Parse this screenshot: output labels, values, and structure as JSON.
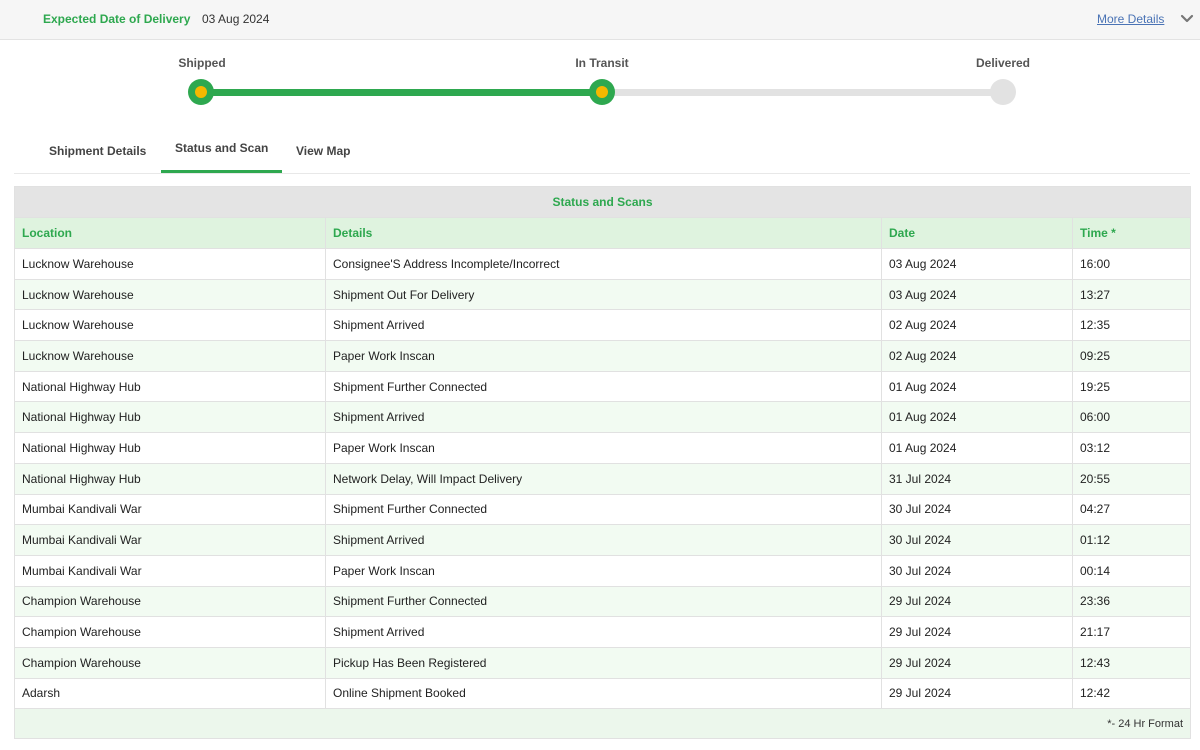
{
  "header": {
    "edd_label": "Expected Date of Delivery",
    "edd_value": "03 Aug 2024",
    "more_details": "More Details"
  },
  "tracker": {
    "stages": [
      "Shipped",
      "In Transit",
      "Delivered"
    ],
    "completed_stages": 2,
    "colors": {
      "done": "#2ea84f",
      "dot": "#f5b800",
      "pending": "#e2e2e2"
    }
  },
  "tabs": [
    "Shipment Details",
    "Status and Scan",
    "View Map"
  ],
  "active_tab": "Status and Scan",
  "table": {
    "caption": "Status and Scans",
    "columns": [
      "Location",
      "Details",
      "Date",
      "Time *"
    ],
    "rows": [
      [
        "Lucknow Warehouse",
        "Consignee'S Address Incomplete/Incorrect",
        "03 Aug 2024",
        "16:00"
      ],
      [
        "Lucknow Warehouse",
        "Shipment Out For Delivery",
        "03 Aug 2024",
        "13:27"
      ],
      [
        "Lucknow Warehouse",
        "Shipment Arrived",
        "02 Aug 2024",
        "12:35"
      ],
      [
        "Lucknow Warehouse",
        "Paper Work Inscan",
        "02 Aug 2024",
        "09:25"
      ],
      [
        "National Highway Hub",
        "Shipment Further Connected",
        "01 Aug 2024",
        "19:25"
      ],
      [
        "National Highway Hub",
        "Shipment Arrived",
        "01 Aug 2024",
        "06:00"
      ],
      [
        "National Highway Hub",
        "Paper Work Inscan",
        "01 Aug 2024",
        "03:12"
      ],
      [
        "National Highway Hub",
        "Network Delay, Will Impact Delivery",
        "31 Jul 2024",
        "20:55"
      ],
      [
        "Mumbai Kandivali War",
        "Shipment Further Connected",
        "30 Jul 2024",
        "04:27"
      ],
      [
        "Mumbai Kandivali War",
        "Shipment Arrived",
        "30 Jul 2024",
        "01:12"
      ],
      [
        "Mumbai Kandivali War",
        "Paper Work Inscan",
        "30 Jul 2024",
        "00:14"
      ],
      [
        "Champion Warehouse",
        "Shipment Further Connected",
        "29 Jul 2024",
        "23:36"
      ],
      [
        "Champion Warehouse",
        "Shipment Arrived",
        "29 Jul 2024",
        "21:17"
      ],
      [
        "Champion Warehouse",
        "Pickup Has Been Registered",
        "29 Jul 2024",
        "12:43"
      ],
      [
        "Adarsh",
        "Online Shipment Booked",
        "29 Jul 2024",
        "12:42"
      ]
    ],
    "footnote": "*- 24 Hr Format"
  }
}
